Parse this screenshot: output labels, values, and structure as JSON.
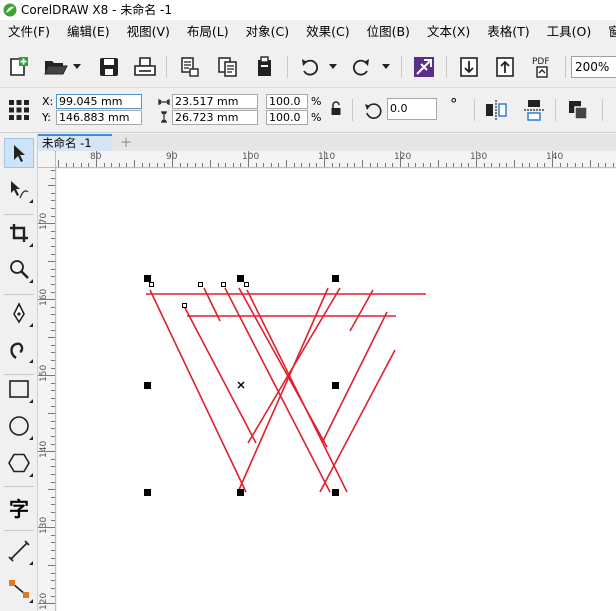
{
  "window": {
    "title": "CorelDRAW X8 - 未命名 -1"
  },
  "menu": [
    "文件(F)",
    "编辑(E)",
    "视图(V)",
    "布局(L)",
    "对象(C)",
    "效果(C)",
    "位图(B)",
    "文本(X)",
    "表格(T)",
    "工具(O)",
    "窗"
  ],
  "toolbar": {
    "zoom": "200%",
    "pdf_label": "PDF"
  },
  "propbar": {
    "x_label": "X:",
    "y_label": "Y:",
    "x_value": "99.045 mm",
    "y_value": "146.883 mm",
    "width_value": "23.517 mm",
    "height_value": "26.723 mm",
    "scale_w": "100.0",
    "scale_h": "100.0",
    "percent": "%",
    "rotation": "0.0",
    "degree": "°"
  },
  "document": {
    "tab_label": "未命名 -1",
    "add_tab": "+"
  },
  "rulers": {
    "horizontal_labels": [
      "80",
      "90",
      "100",
      "110",
      "120",
      "130",
      "140"
    ],
    "vertical_labels": [
      "170",
      "160",
      "150",
      "140",
      "130",
      "120"
    ]
  },
  "colors": {
    "stroke": "#e0202e",
    "accent": "#3c8ad8",
    "selected_tool_bg": "#cde3f7"
  },
  "tools": [
    "pick-tool",
    "shape-tool",
    "crop-tool",
    "zoom-tool",
    "freehand-tool",
    "artistic-media-tool",
    "rectangle-tool",
    "ellipse-tool",
    "polygon-tool",
    "text-tool",
    "parallel-dimension-tool",
    "connector-tool"
  ],
  "text_tool_glyph": "字"
}
